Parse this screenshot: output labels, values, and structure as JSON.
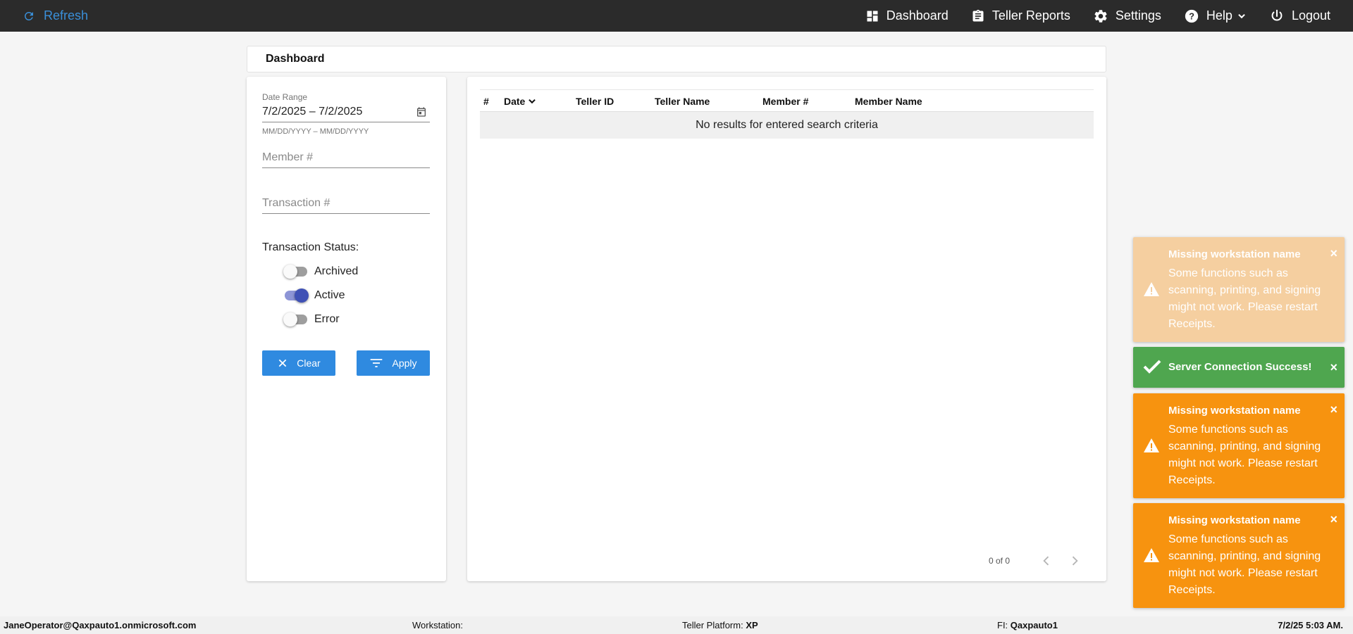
{
  "topbar": {
    "refresh_label": "Refresh",
    "nav": {
      "dashboard": "Dashboard",
      "teller_reports": "Teller Reports",
      "settings": "Settings",
      "help": "Help",
      "logout": "Logout"
    }
  },
  "header": {
    "title": "Dashboard"
  },
  "filters": {
    "date_range_label": "Date Range",
    "date_range_value": "7/2/2025 – 7/2/2025",
    "date_range_hint": "MM/DD/YYYY – MM/DD/YYYY",
    "member_placeholder": "Member #",
    "transaction_placeholder": "Transaction #",
    "status_title": "Transaction Status:",
    "statuses": [
      {
        "label": "Archived",
        "on": false
      },
      {
        "label": "Active",
        "on": true
      },
      {
        "label": "Error",
        "on": false
      }
    ],
    "clear_label": "Clear",
    "apply_label": "Apply"
  },
  "table": {
    "columns": [
      "#",
      "Date",
      "Teller ID",
      "Teller Name",
      "Member #",
      "Member Name"
    ],
    "empty_message": "No results for entered search criteria",
    "pager_count": "0 of 0"
  },
  "toasts": [
    {
      "type": "warning-faded",
      "title": "Missing workstation name",
      "body": "Some functions such as scanning, printing, and signing might not work. Please restart Receipts."
    },
    {
      "type": "success",
      "title": "Server Connection Success!",
      "body": ""
    },
    {
      "type": "warning",
      "title": "Missing workstation name",
      "body": "Some functions such as scanning, printing, and signing might not work. Please restart Receipts."
    },
    {
      "type": "warning",
      "title": "Missing workstation name",
      "body": "Some functions such as scanning, printing, and signing might not work. Please restart Receipts."
    }
  ],
  "toast_close": "×",
  "statusbar": {
    "user": "JaneOperator@Qaxpauto1.onmicrosoft.com",
    "workstation_label": "Workstation:",
    "workstation_value": "",
    "platform_label": "Teller Platform:",
    "platform_value": "XP",
    "fi_label": "FI:",
    "fi_value": "Qaxpauto1",
    "datetime": "7/2/25 5:03 AM."
  },
  "colors": {
    "topbar_bg": "#2b2b2b",
    "accent_blue": "#2f8ae0",
    "toggle_on": "#3f51b5",
    "toast_warning": "#f7930f",
    "toast_success": "#4fa64f"
  }
}
